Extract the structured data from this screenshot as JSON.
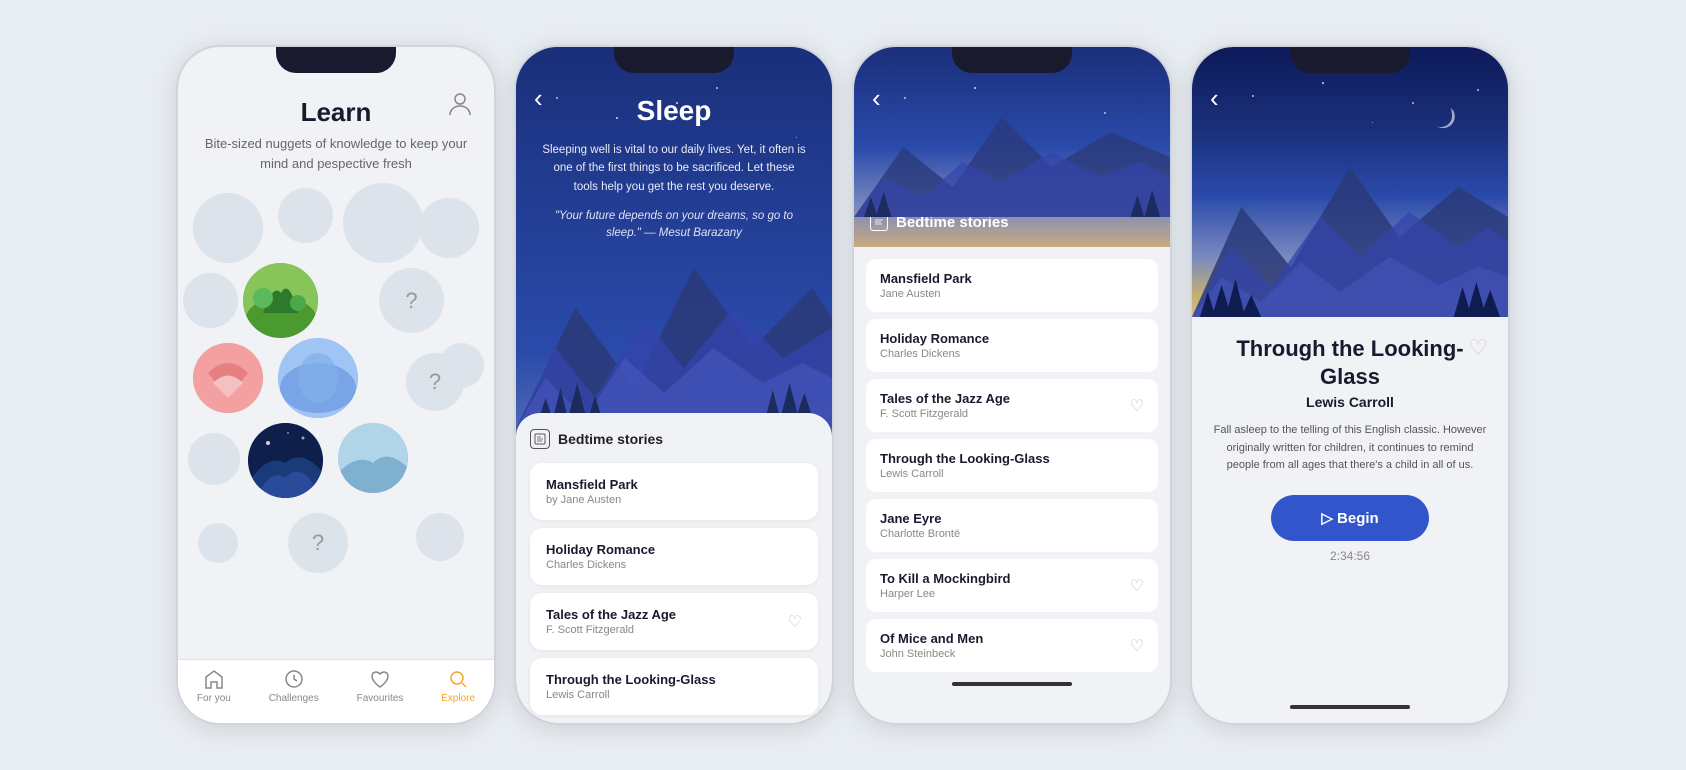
{
  "screens": {
    "screen1": {
      "title": "Learn",
      "subtitle": "Bite-sized nuggets of knowledge to keep your mind and pespective fresh",
      "nav": {
        "items": [
          {
            "id": "for-you",
            "label": "For you",
            "active": false
          },
          {
            "id": "challenges",
            "label": "Challenges",
            "active": false
          },
          {
            "id": "favourites",
            "label": "Favourites",
            "active": false
          },
          {
            "id": "explore",
            "label": "Explore",
            "active": true
          }
        ]
      }
    },
    "screen2": {
      "back": "‹",
      "title": "Sleep",
      "description": "Sleeping well is vital to our daily lives. Yet, it often is one of the first things to be sacrificed. Let these tools help you get the rest you deserve.",
      "quote": "\"Your future depends on your dreams, so go to sleep.\" — Mesut Barazany",
      "section": {
        "title": "Bedtime stories",
        "stories": [
          {
            "title": "Mansfield Park",
            "author": "by Jane Austen",
            "has_heart": false
          },
          {
            "title": "Holiday Romance",
            "author": "Charles Dickens",
            "has_heart": false
          },
          {
            "title": "Tales of the Jazz Age",
            "author": "F. Scott Fitzgerald",
            "has_heart": true
          },
          {
            "title": "Through the Looking-Glass",
            "author": "Lewis Carroll",
            "has_heart": false
          }
        ]
      }
    },
    "screen3": {
      "back": "‹",
      "section_title": "Bedtime stories",
      "stories": [
        {
          "title": "Mansfield Park",
          "author": "Jane Austen",
          "has_heart": false
        },
        {
          "title": "Holiday Romance",
          "author": "Charles Dickens",
          "has_heart": false
        },
        {
          "title": "Tales of the Jazz Age",
          "author": "F. Scott Fitzgerald",
          "has_heart": true
        },
        {
          "title": "Through the Looking-Glass",
          "author": "Lewis Carroll",
          "has_heart": false
        },
        {
          "title": "Jane Eyre",
          "author": "Charlotte Brontë",
          "has_heart": false
        },
        {
          "title": "To Kill a Mockingbird",
          "author": "Harper Lee",
          "has_heart": true
        },
        {
          "title": "Of Mice and Men",
          "author": "John Steinbeck",
          "has_heart": true
        }
      ]
    },
    "screen4": {
      "back": "‹",
      "title": "Through the Looking-Glass",
      "author": "Lewis Carroll",
      "description": "Fall asleep to the telling of this English classic. However originally written for children, it continues to remind people from all ages that there's a child in all of us.",
      "begin_label": "▷ Begin",
      "duration": "2:34:56"
    }
  }
}
